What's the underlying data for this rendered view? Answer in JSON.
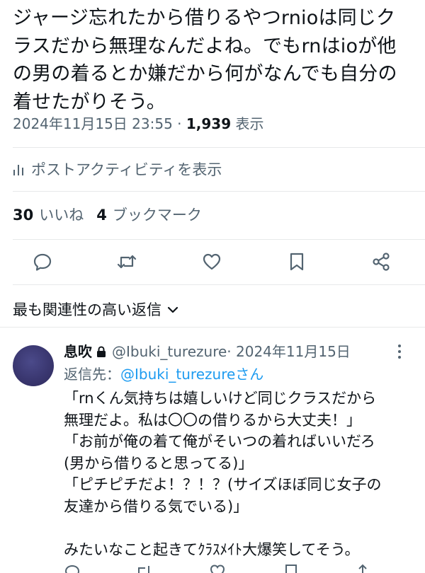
{
  "post": {
    "lines": [
      "ジャージ忘れたから借りるやつrnioは同じク",
      "ラスだから無理なんだよね。でもrnはioが他",
      "の男の着るとか嫌だから何がなんでも自分の",
      "着せたがりそう。"
    ],
    "datetime": "2024年11月15日 23:55",
    "separator": " · ",
    "views": "1,939",
    "views_label": "表示"
  },
  "activity": {
    "label": "ポストアクティビティを表示",
    "icon": "analytics-icon"
  },
  "stats": {
    "likes_count": "30",
    "likes_label": "いいね",
    "bookmarks_count": "4",
    "bookmarks_label": "ブックマーク"
  },
  "actions": [
    "reply-icon",
    "retweet-icon",
    "like-icon",
    "bookmark-icon",
    "share-icon"
  ],
  "sort": {
    "label": "最も関連性の高い返信",
    "icon": "chevron-down-icon"
  },
  "reply": {
    "name": "息吹",
    "handle": "@Ibuki_turezure",
    "date": " · 2024年11月15日",
    "reply_to_prefix": "返信先：",
    "reply_to_handle": "@Ibuki_turezureさん",
    "lines": [
      "「rnくん気持ちは嬉しいけど同じクラスだから",
      "無理だよ。私は〇〇の借りるから大丈夫！」",
      "「お前が俺の着て俺がそいつの着ればいいだろ",
      "(男から借りると思ってる)」",
      "「ピチピチだよ！？！？(サイズほぼ同じ女子の",
      "友達から借りる気でいる)」",
      "",
      "みたいなこと起きてｸﾗｽﾒｲﾄ大爆笑してそう。"
    ]
  },
  "colors": {
    "text": "#0f1419",
    "secondary": "#536471",
    "link": "#1d9bf0",
    "divider": "#e7e9ea"
  }
}
